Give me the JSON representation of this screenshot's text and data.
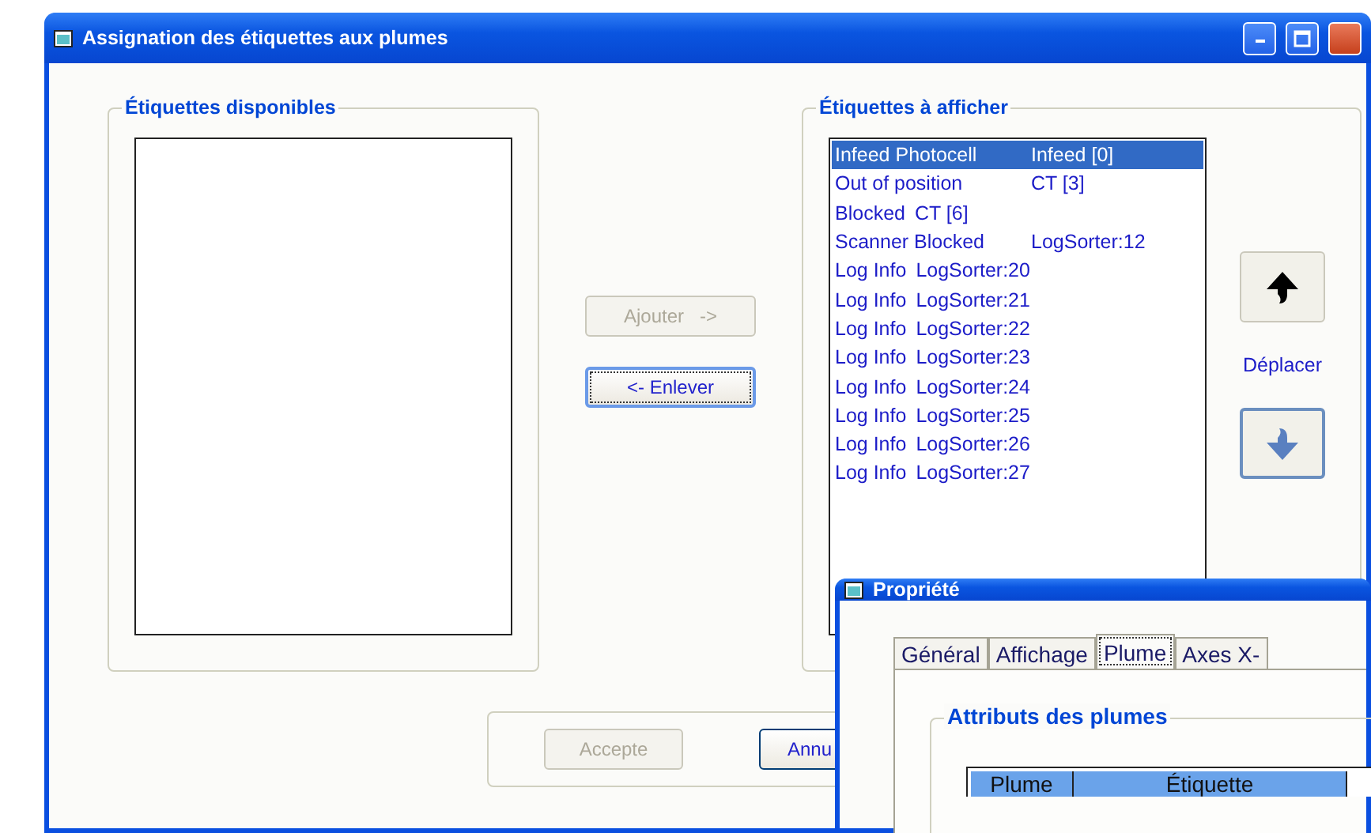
{
  "main_window": {
    "title": "Assignation des étiquettes aux plumes",
    "available_group": {
      "title": "Étiquettes disponibles"
    },
    "add_button": {
      "label": "Ajouter   ->",
      "disabled": true
    },
    "remove_button": {
      "label": "<- Enlever",
      "disabled": false,
      "focused": true
    },
    "display_group": {
      "title": "Étiquettes à afficher",
      "items": [
        {
          "name": "Infeed Photocell",
          "tag": "Infeed [0]",
          "selected": true
        },
        {
          "name": "Out of position",
          "tag": "CT [3]",
          "selected": false
        },
        {
          "name": "Blocked",
          "tag": "CT [6]",
          "selected": false
        },
        {
          "name": "Scanner Blocked",
          "tag": "LogSorter:12",
          "selected": false
        },
        {
          "name": "Log Info",
          "tag": "LogSorter:20",
          "selected": false
        },
        {
          "name": "Log Info",
          "tag": "LogSorter:21",
          "selected": false
        },
        {
          "name": "Log Info",
          "tag": "LogSorter:22",
          "selected": false
        },
        {
          "name": "Log Info",
          "tag": "LogSorter:23",
          "selected": false
        },
        {
          "name": "Log Info",
          "tag": "LogSorter:24",
          "selected": false
        },
        {
          "name": "Log Info",
          "tag": "LogSorter:25",
          "selected": false
        },
        {
          "name": "Log Info",
          "tag": "LogSorter:26",
          "selected": false
        },
        {
          "name": "Log Info",
          "tag": "LogSorter:27",
          "selected": false
        }
      ]
    },
    "move_label": "Déplacer",
    "accept_button": {
      "label": "Accepte",
      "disabled": true
    },
    "cancel_button": {
      "label": "Annu",
      "disabled": false
    }
  },
  "property_window": {
    "title": "Propriété",
    "tabs": [
      {
        "label": "Général",
        "selected": false
      },
      {
        "label": "Affichage",
        "selected": false
      },
      {
        "label": "Plume",
        "selected": true
      },
      {
        "label": "Axes X-",
        "selected": false
      }
    ],
    "group": {
      "title": "Attributs des plumes"
    },
    "table": {
      "columns": [
        "Plume",
        "Étiquette"
      ]
    }
  }
}
